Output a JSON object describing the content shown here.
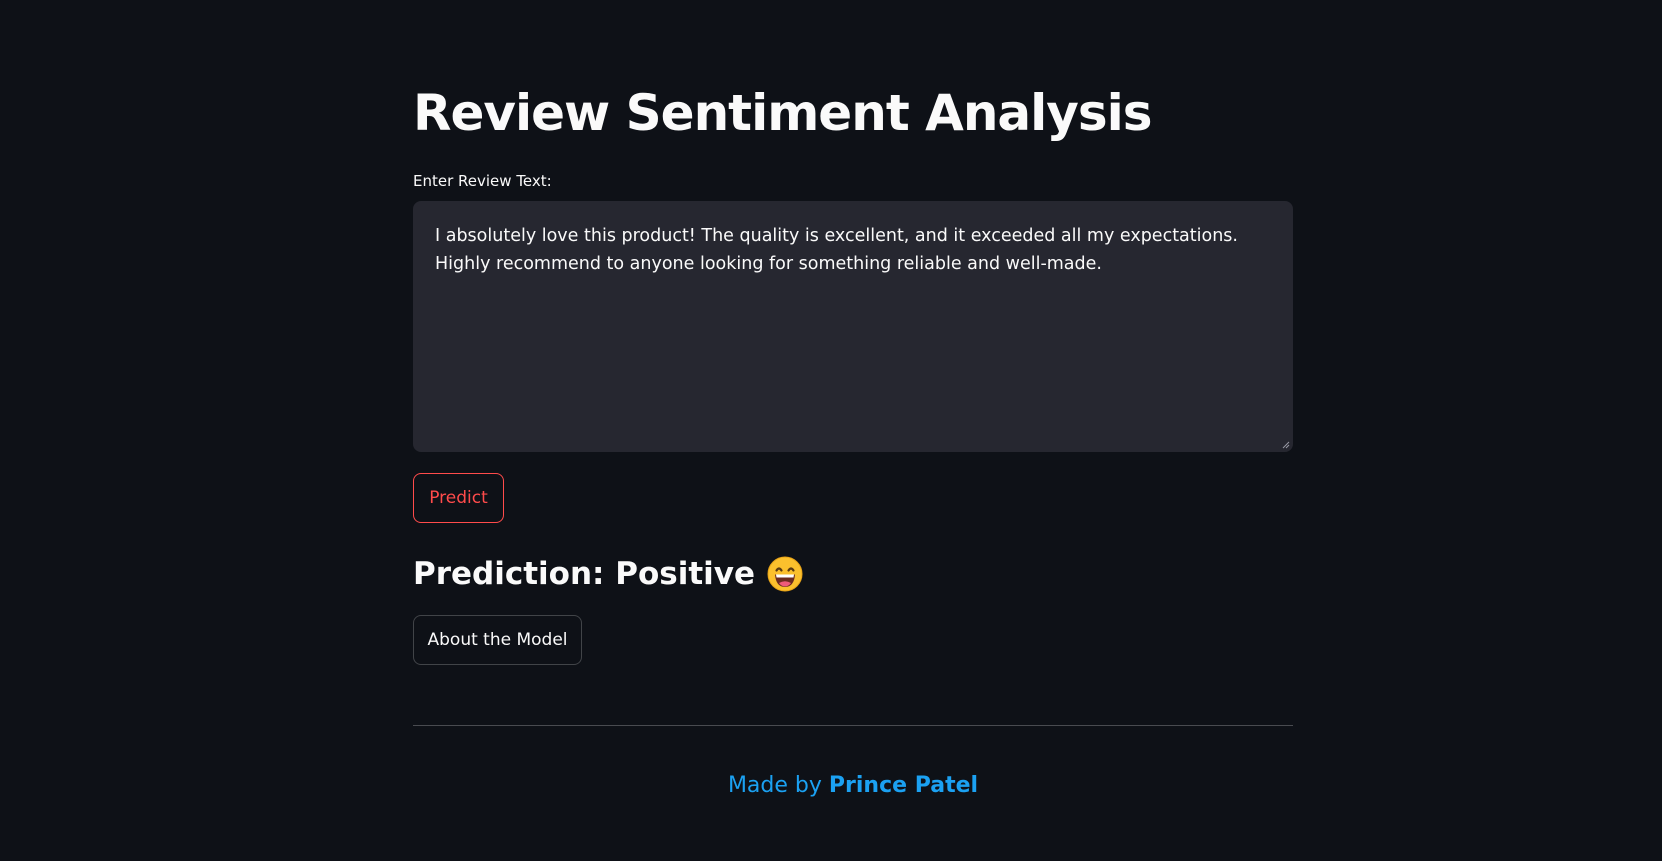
{
  "page": {
    "title": "Review Sentiment Analysis"
  },
  "review_input": {
    "label": "Enter Review Text:",
    "value": "I absolutely love this product! The quality is excellent, and it exceeded all my expectations. Highly recommend to anyone looking for something reliable and well-made."
  },
  "actions": {
    "predict_label": "Predict",
    "about_label": "About the Model"
  },
  "result": {
    "text": "Prediction: Positive",
    "emoji_icon": "grinning-face-icon"
  },
  "footer": {
    "prefix": "Made by ",
    "author": "Prince Patel"
  },
  "colors": {
    "background": "#0e1117",
    "input_background": "#262730",
    "primary": "#ff4b4b",
    "footer_link": "#1ba1f2",
    "text": "#fafafa"
  }
}
